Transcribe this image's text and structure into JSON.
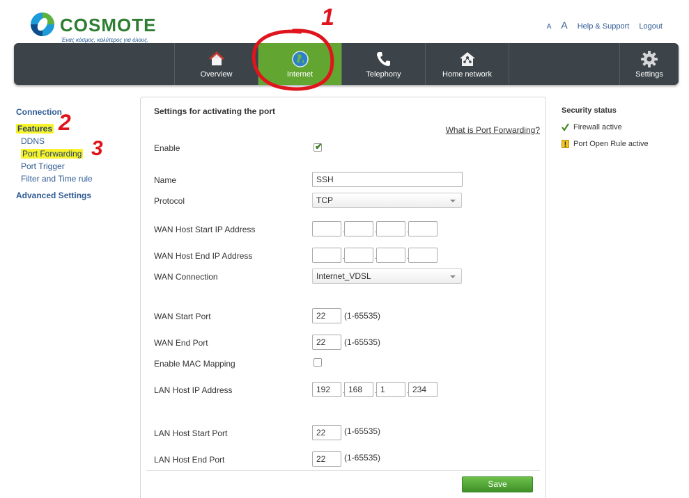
{
  "brand": {
    "name": "COSMOTE",
    "tagline": "Ένας κόσμος, καλύτερος για όλους.",
    "logo_colors": [
      "#1c9bd8",
      "#5cb23a",
      "#0d4f8b"
    ]
  },
  "top_links": {
    "font_small": "A",
    "font_big": "A",
    "help": "Help & Support",
    "logout": "Logout"
  },
  "nav": {
    "items": [
      {
        "label": "Overview",
        "icon": "house-icon"
      },
      {
        "label": "Internet",
        "icon": "globe-icon",
        "active": true
      },
      {
        "label": "Telephony",
        "icon": "phone-icon"
      },
      {
        "label": "Home network",
        "icon": "home-network-icon"
      },
      {
        "label": "Settings",
        "icon": "gear-icon"
      }
    ],
    "active_color": "#62a531",
    "bar_color": "#3c4449"
  },
  "sidebar": {
    "connection": "Connection",
    "features": "Features",
    "ddns": "DDNS",
    "port_forwarding": "Port Forwarding",
    "port_trigger": "Port Trigger",
    "filter_time": "Filter and Time rule",
    "advanced": "Advanced Settings"
  },
  "form": {
    "title": "Settings for activating the port",
    "help_link": "What is Port Forwarding?",
    "enable_label": "Enable",
    "enable_checked": true,
    "name_label": "Name",
    "name_value": "SSH",
    "protocol_label": "Protocol",
    "protocol_value": "TCP",
    "wan_start_ip_label": "WAN Host Start IP Address",
    "wan_start_ip": [
      "",
      "",
      "",
      ""
    ],
    "wan_end_ip_label": "WAN Host End IP Address",
    "wan_end_ip": [
      "",
      "",
      "",
      ""
    ],
    "wan_conn_label": "WAN Connection",
    "wan_conn_value": "Internet_VDSL",
    "wan_start_port_label": "WAN Start Port",
    "wan_start_port": "22",
    "wan_end_port_label": "WAN End Port",
    "wan_end_port": "22",
    "mac_mapping_label": "Enable MAC Mapping",
    "mac_mapping_checked": false,
    "lan_ip_label": "LAN Host IP Address",
    "lan_ip": [
      "192",
      "168",
      "1",
      "234"
    ],
    "lan_start_port_label": "LAN Host Start Port",
    "lan_start_port": "22",
    "lan_end_port_label": "LAN Host End Port",
    "lan_end_port": "22",
    "port_range": "(1-65535)",
    "save": "Save"
  },
  "security": {
    "title": "Security status",
    "firewall": "Firewall active",
    "open_rule": "Port Open Rule active"
  },
  "annotations": {
    "step1": "1",
    "step2": "2",
    "step3": "3",
    "color": "#e0141c"
  }
}
